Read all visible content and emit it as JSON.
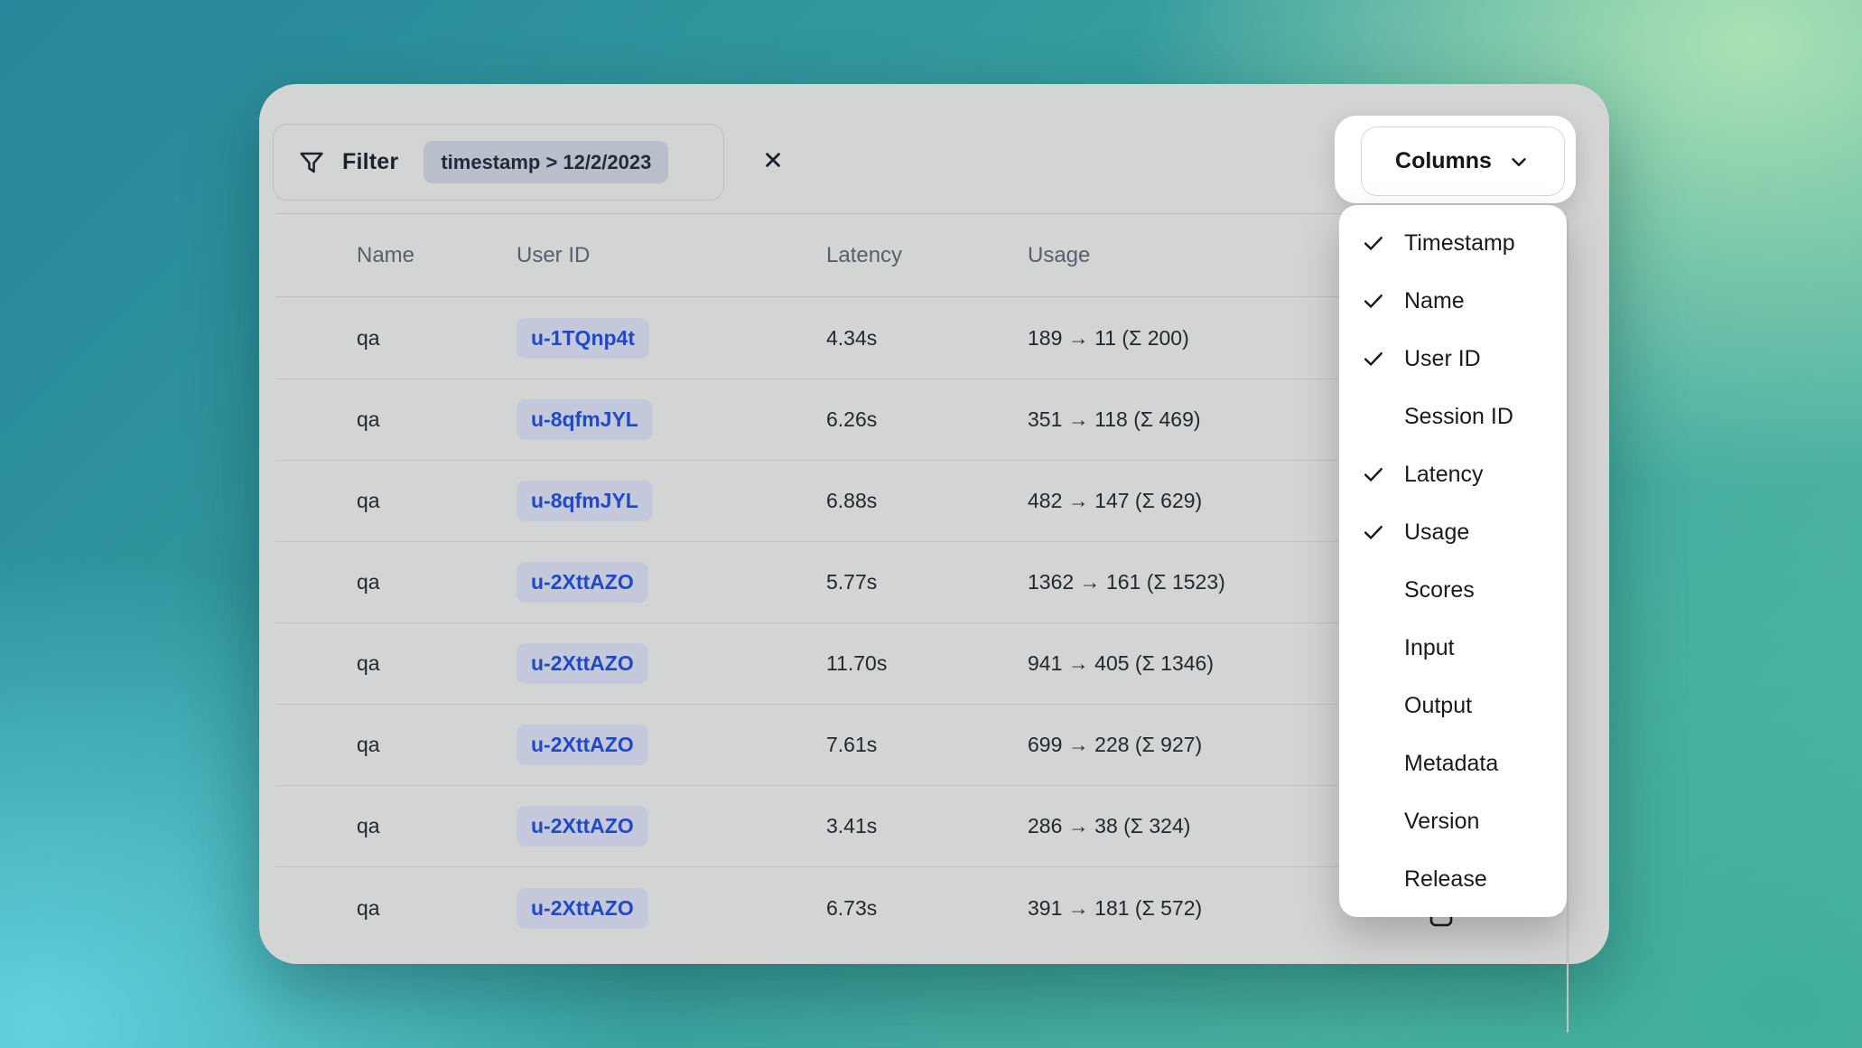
{
  "colors": {
    "accent_blue": "#2149c6",
    "card_background": "#d3d4d4",
    "menu_background": "#ffffff",
    "chip_background": "#c3c9db",
    "filter_chip_background": "#b9bfca",
    "background_gradient_corners": [
      "#2a8f9c",
      "#aee3b4",
      "#63d3de",
      "#40ab9c"
    ]
  },
  "toolbar": {
    "filter_label": "Filter",
    "filter_chip": "timestamp > 12/2/2023"
  },
  "columns_button": {
    "label": "Columns"
  },
  "columns_menu": {
    "items": [
      {
        "label": "Timestamp",
        "checked": true
      },
      {
        "label": "Name",
        "checked": true
      },
      {
        "label": "User ID",
        "checked": true
      },
      {
        "label": "Session ID",
        "checked": false
      },
      {
        "label": "Latency",
        "checked": true
      },
      {
        "label": "Usage",
        "checked": true
      },
      {
        "label": "Scores",
        "checked": false
      },
      {
        "label": "Input",
        "checked": false
      },
      {
        "label": "Output",
        "checked": false
      },
      {
        "label": "Metadata",
        "checked": false
      },
      {
        "label": "Version",
        "checked": false
      },
      {
        "label": "Release",
        "checked": false
      }
    ]
  },
  "table": {
    "headers": [
      "Name",
      "User ID",
      "Latency",
      "Usage"
    ],
    "rows": [
      {
        "name": "qa",
        "user_id": "u-1TQnp4t",
        "latency": "4.34s",
        "usage": "189 → 11 (Σ 200)"
      },
      {
        "name": "qa",
        "user_id": "u-8qfmJYL",
        "latency": "6.26s",
        "usage": "351 → 118 (Σ 469)"
      },
      {
        "name": "qa",
        "user_id": "u-8qfmJYL",
        "latency": "6.88s",
        "usage": "482 → 147 (Σ 629)"
      },
      {
        "name": "qa",
        "user_id": "u-2XttAZO",
        "latency": "5.77s",
        "usage": "1362 → 161 (Σ 1523)"
      },
      {
        "name": "qa",
        "user_id": "u-2XttAZO",
        "latency": "11.70s",
        "usage": "941 → 405 (Σ 1346)"
      },
      {
        "name": "qa",
        "user_id": "u-2XttAZO",
        "latency": "7.61s",
        "usage": "699 → 228 (Σ 927)"
      },
      {
        "name": "qa",
        "user_id": "u-2XttAZO",
        "latency": "3.41s",
        "usage": "286 → 38 (Σ 324)"
      },
      {
        "name": "qa",
        "user_id": "u-2XttAZO",
        "latency": "6.73s",
        "usage": "391 → 181 (Σ 572)"
      }
    ]
  }
}
